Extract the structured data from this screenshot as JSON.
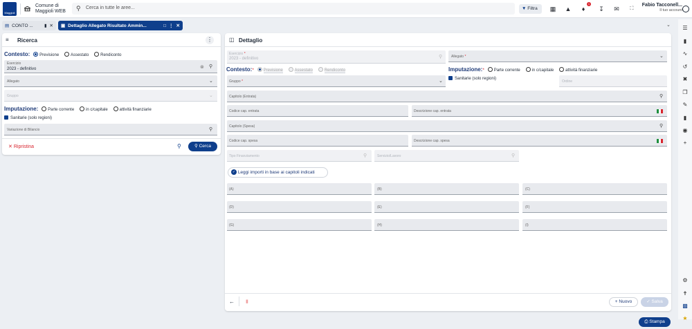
{
  "topbar": {
    "logo_text": "Maggioli",
    "municipality": "Comune di",
    "municipality2": "Maggioli WEB",
    "search_placeholder": "Cerca in tutte le aree...",
    "filter_label": "Filtra",
    "notification_count": "1",
    "user_name": "Fabio Tacconell...",
    "user_sub": "Il tuo account"
  },
  "tabs": [
    {
      "label": "CONTO ...",
      "active": false
    },
    {
      "label": "Dettaglio Allegato Risultato Ammin...",
      "active": true
    }
  ],
  "left": {
    "title": "Ricerca",
    "contesto_label": "Contesto:",
    "contesto_options": [
      "Previsione",
      "Assestato",
      "Rendiconto"
    ],
    "esercizio_label": "Esercizio",
    "esercizio_value": "2023 - definitivo",
    "allegato_label": "Allegato",
    "gruppo_label": "Gruppo",
    "imputazione_label": "Imputazione:",
    "imputazione_options": [
      "Parte corrente",
      "in c/capitale",
      "attività finanziarie"
    ],
    "sanitarie_label": "Sanitarie (solo regioni)",
    "variazione_label": "Variazione di Bilancio",
    "reset_label": "Ripristina",
    "search_label": "Cerca"
  },
  "right": {
    "title": "Dettaglio",
    "esercizio_label": "Esercizio",
    "esercizio_value": "2023 - definitivo",
    "allegato_label": "Allegato",
    "contesto_label": "Contesto:",
    "contesto_options": [
      "Previsione",
      "Assestato",
      "Rendiconto"
    ],
    "imputazione_label": "Imputazione:",
    "imputazione_options": [
      "Parte corrente",
      "in c/capitale",
      "attività finanziarie"
    ],
    "gruppo_label": "Gruppo",
    "sanitarie_label": "Sanitarie (solo regioni)",
    "ordine_label": "Ordine",
    "capitolo_entrata_label": "Capitolo (Entrata)",
    "codice_entrata_label": "Codice cap. entrata",
    "descrizione_entrata_label": "Descrizione cap. entrata",
    "capitolo_spesa_label": "Capitolo (Spesa)",
    "codice_spesa_label": "Codice cap. spesa",
    "descrizione_spesa_label": "Descrizione cap. spesa",
    "tipo_finanziamento_label": "Tipo Finanziamento",
    "servizio_lavoro_label": "Servizio/Lavoro",
    "leggi_label": "Leggi importi in base ai capitoli indicati",
    "importi": [
      "(A)",
      "(B)",
      "(C)",
      "(D)",
      "(E)",
      "(F)",
      "(G)",
      "(H)",
      "(I)"
    ],
    "nuovo_label": "Nuovo",
    "salva_label": "Salva"
  },
  "stampa_label": "Stampa",
  "colors": {
    "primary": "#0f3f8c",
    "danger": "#d8252f",
    "accent_title": "#1f3b78"
  }
}
